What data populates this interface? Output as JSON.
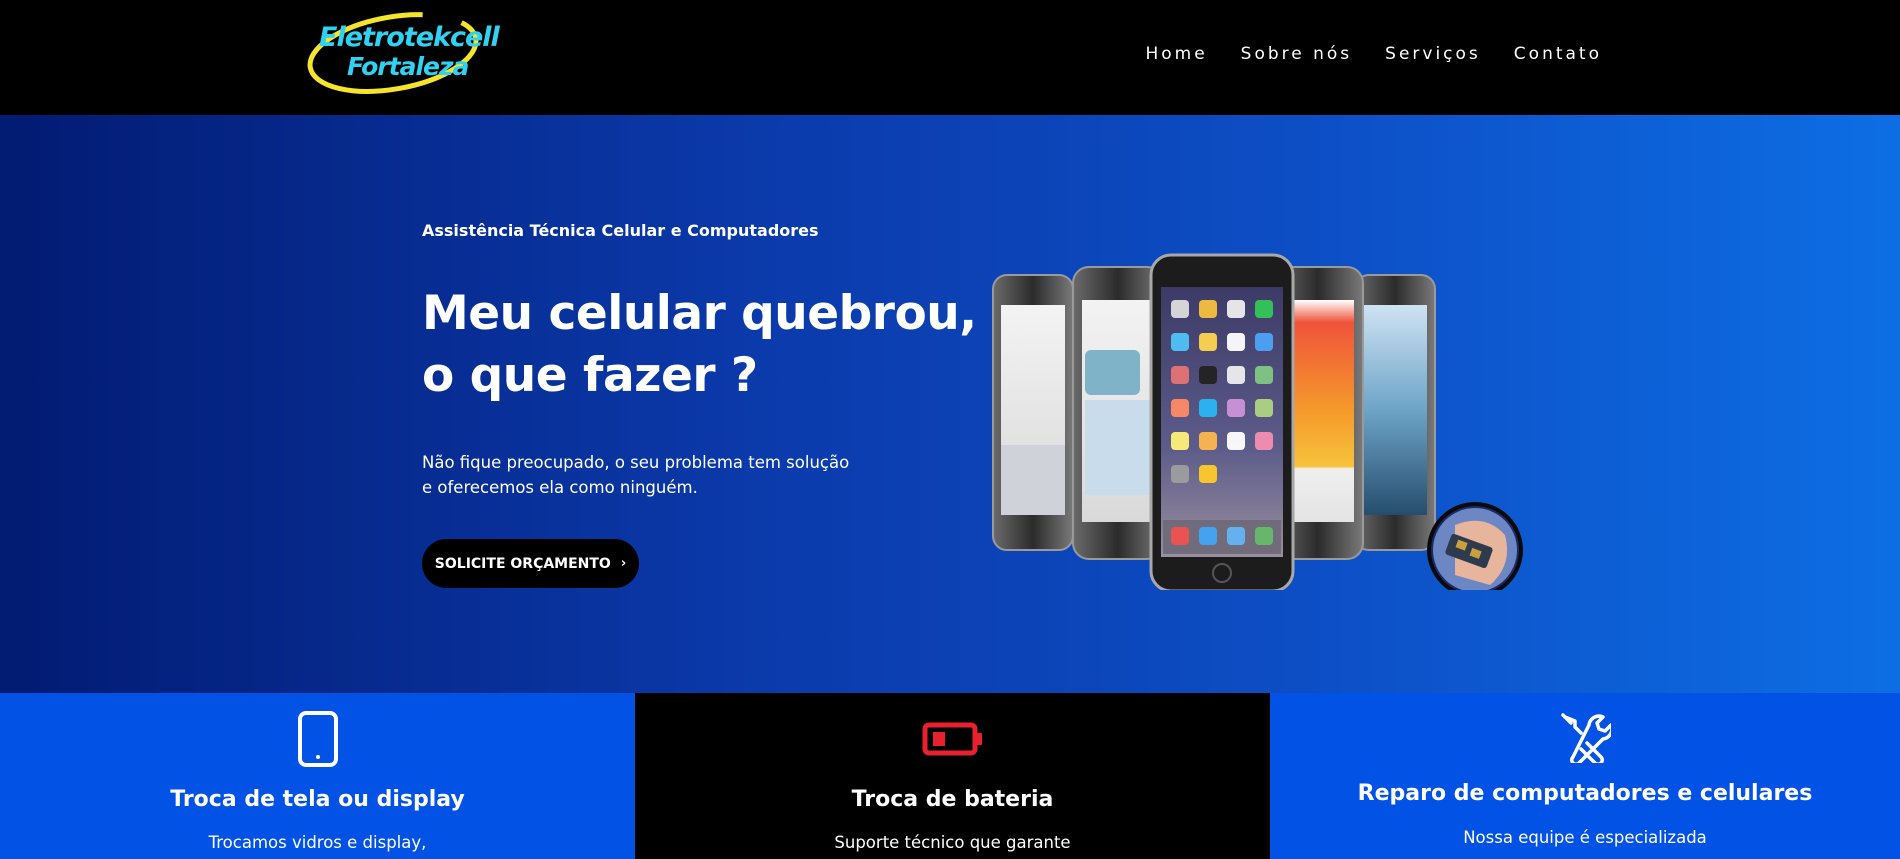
{
  "header": {
    "logo": {
      "line1": "Eletrotekcell",
      "line2": "Fortaleza"
    },
    "nav": [
      {
        "label": "Home"
      },
      {
        "label": "Sobre nós"
      },
      {
        "label": "Serviços"
      },
      {
        "label": "Contato"
      }
    ]
  },
  "hero": {
    "eyebrow": "Assistência Técnica Celular e Computadores",
    "headline": {
      "line1": "Meu celular  quebrou,",
      "line2": "o que fazer ?"
    },
    "lead": {
      "line1": "Não fique preocupado, o seu problema tem solução",
      "line2": "e oferecemos ela como ninguém."
    },
    "cta": {
      "label": "SOLICITE ORÇAMENTO",
      "icon": "chevron-right-icon"
    }
  },
  "features": [
    {
      "icon": "smartphone-icon",
      "title": "Troca de tela ou display",
      "desc": "Trocamos vidros e display,",
      "bg": "#0252e6"
    },
    {
      "icon": "battery-low-icon",
      "title": "Troca de bateria",
      "desc": "Suporte técnico que garante",
      "bg": "#000000"
    },
    {
      "icon": "tools-icon",
      "title": "Reparo de computadores e celulares",
      "desc": "Nossa equipe é especializada",
      "bg": "#0252e6"
    }
  ],
  "colors": {
    "header_bg": "#000000",
    "logo_text": "#2fd2f2",
    "logo_ring": "#f5e52a",
    "hero_gradient_start": "#021b73",
    "hero_gradient_end": "#0d6ee4",
    "battery_accent": "#e8212f"
  }
}
